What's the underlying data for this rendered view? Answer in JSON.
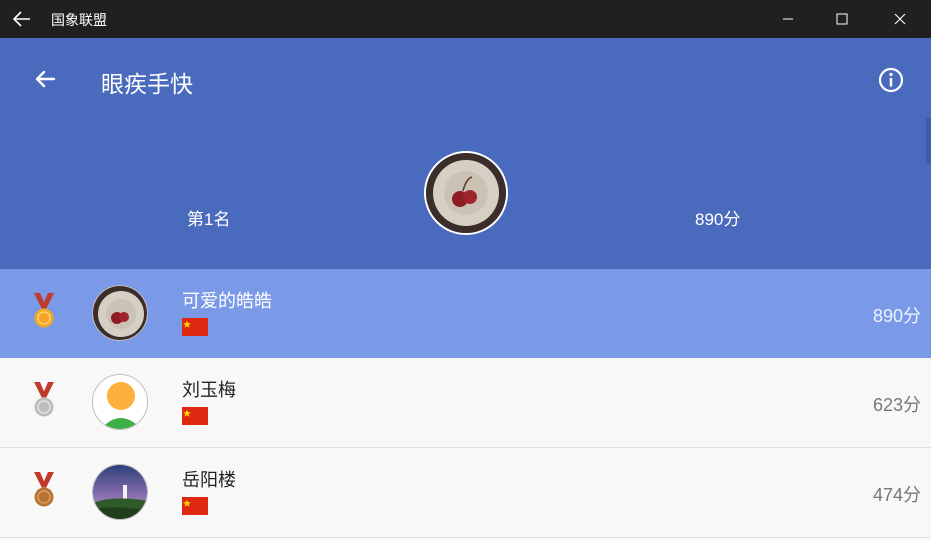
{
  "window": {
    "title": "国象联盟",
    "icons": {
      "back": "back-arrow-icon",
      "minimize": "minimize-icon",
      "maximize": "maximize-icon",
      "close": "close-icon"
    }
  },
  "header": {
    "title": "眼疾手快",
    "rank": "第1名",
    "score": "890分",
    "colors": {
      "background": "#4a6bbd"
    },
    "icons": {
      "back": "back-arrow-icon",
      "info": "info-icon"
    }
  },
  "leaderboard": {
    "rows": [
      {
        "name": "可爱的皓皓",
        "score": "890分",
        "medal": "gold",
        "flag": "china-flag",
        "highlighted": true
      },
      {
        "name": "刘玉梅",
        "score": "623分",
        "medal": "silver",
        "flag": "china-flag",
        "highlighted": false
      },
      {
        "name": "岳阳楼",
        "score": "474分",
        "medal": "bronze",
        "flag": "china-flag",
        "highlighted": false
      }
    ],
    "colors": {
      "highlight": "#7a9ae8",
      "gold": "#f5a623",
      "silver": "#bdbdbd",
      "bronze": "#b87333",
      "ribbon": "#c0392b"
    }
  }
}
